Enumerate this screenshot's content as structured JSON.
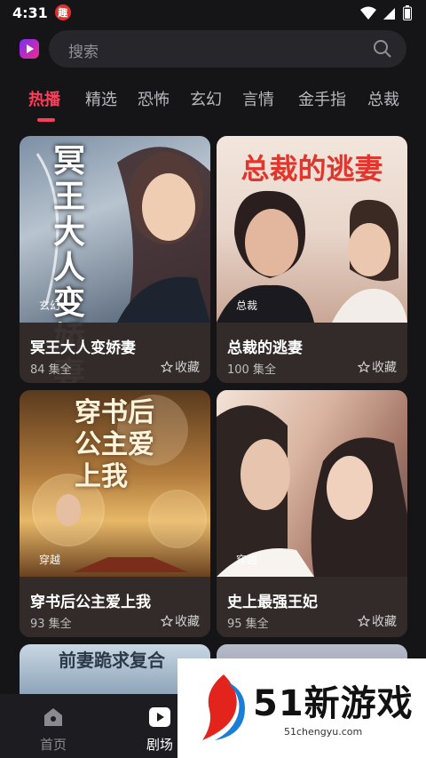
{
  "status": {
    "time": "4:31",
    "app_badge": "趣"
  },
  "search": {
    "placeholder": "搜索"
  },
  "tabs": [
    {
      "label": "热播"
    },
    {
      "label": "精选"
    },
    {
      "label": "恐怖"
    },
    {
      "label": "玄幻"
    },
    {
      "label": "言情"
    },
    {
      "label": "金手指"
    },
    {
      "label": "总裁"
    }
  ],
  "cards": [
    {
      "poster_text": "冥王大人变娇妻",
      "genre": "玄幻",
      "title": "冥王大人变娇妻",
      "episodes": "84 集全",
      "fav": "收藏"
    },
    {
      "poster_text": "总裁的逃妻",
      "genre": "总裁",
      "title": "总裁的逃妻",
      "episodes": "100 集全",
      "fav": "收藏"
    },
    {
      "poster_text": "穿书后公主爱上我",
      "genre": "穿越",
      "title": "穿书后公主爱上我",
      "episodes": "93 集全",
      "fav": "收藏"
    },
    {
      "poster_text": "",
      "genre": "穿越",
      "title": "史上最强王妃",
      "episodes": "95 集全",
      "fav": "收藏"
    }
  ],
  "partial_card": {
    "poster_text": "前妻跪求复合"
  },
  "nav": {
    "home": "首页",
    "theater": "剧场"
  },
  "watermark": {
    "title": "51新游戏",
    "url": "51chengyu.com"
  },
  "colors": {
    "accent": "#ff3d5a",
    "background": "#151518"
  }
}
